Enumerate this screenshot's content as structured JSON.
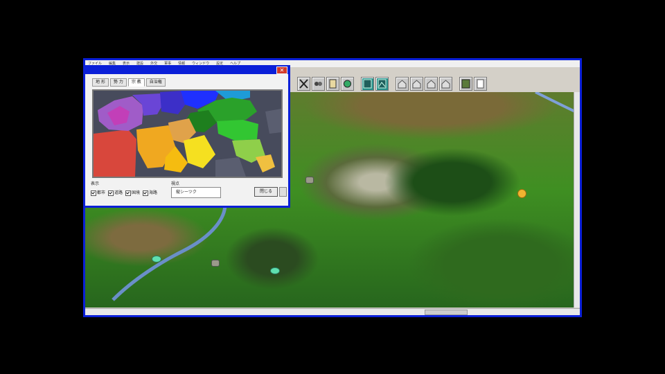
{
  "menubar": {
    "items": [
      "ファイル",
      "編集",
      "表示",
      "建設",
      "外交",
      "軍事",
      "情報",
      "ウィンドウ",
      "設定",
      "ヘルプ"
    ]
  },
  "dialog": {
    "close_glyph": "✕",
    "tabs": [
      "地 形",
      "勢 力",
      "宗 教",
      "自治権"
    ],
    "display_group_label": "表示",
    "checkboxes": [
      "都市",
      "道路",
      "国境",
      "海路"
    ],
    "view_group_label": "視点",
    "view_select_value": "縦シーツク",
    "close_button_label": "閉じる"
  },
  "map": {
    "markers": [
      "teal-unit",
      "teal-unit",
      "stone-unit",
      "gold-unit",
      "stone-unit"
    ]
  },
  "colors": {
    "window_border": "#0a1fd8",
    "dialog_close": "#d23a2a"
  }
}
